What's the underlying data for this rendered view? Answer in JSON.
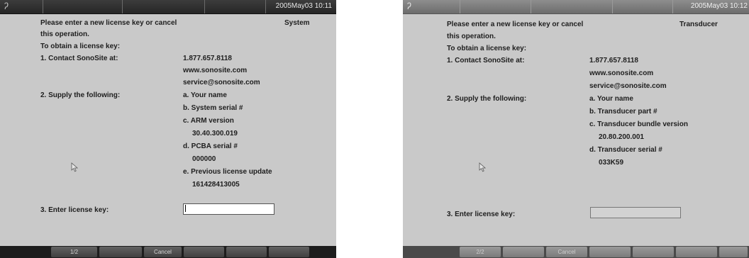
{
  "left": {
    "datetime": "2005May03 10:11",
    "mode_label": "System",
    "instruction_line1": "Please enter a new license key or cancel",
    "instruction_line2": "this operation.",
    "obtain_heading": "To obtain a license key:",
    "step1_label": "1. Contact SonoSite at:",
    "phone": "1.877.657.8118",
    "website": "www.sonosite.com",
    "email": "service@sonosite.com",
    "step2_label": "2. Supply the following:",
    "supply_items": [
      "a. Your name",
      "b. System serial #",
      "c. ARM version",
      "30.40.300.019",
      "d. PCBA serial #",
      "000000",
      "e. Previous license update",
      "161428413005"
    ],
    "step3_label": "3. Enter license key:",
    "license_key_value": "",
    "softkeys": [
      "1/2",
      "Cancel"
    ]
  },
  "right": {
    "datetime": "2005May03 10:12",
    "mode_label": "Transducer",
    "instruction_line1": "Please enter a new license key or cancel",
    "instruction_line2": "this operation.",
    "obtain_heading": "To obtain a license key:",
    "step1_label": "1. Contact SonoSite at:",
    "phone": "1.877.657.8118",
    "website": "www.sonosite.com",
    "email": "service@sonosite.com",
    "step2_label": "2. Supply the following:",
    "supply_items": [
      "a. Your name",
      "b. Transducer part #",
      "c. Transducer bundle version",
      "20.80.200.001",
      "d. Transducer serial #",
      "033K59"
    ],
    "step3_label": "3. Enter license key:",
    "license_key_value": "",
    "softkeys": [
      "2/2",
      "Cancel"
    ]
  },
  "icons": {
    "logo": "sonosite-logo-icon",
    "cursor": "mouse-pointer-icon"
  }
}
